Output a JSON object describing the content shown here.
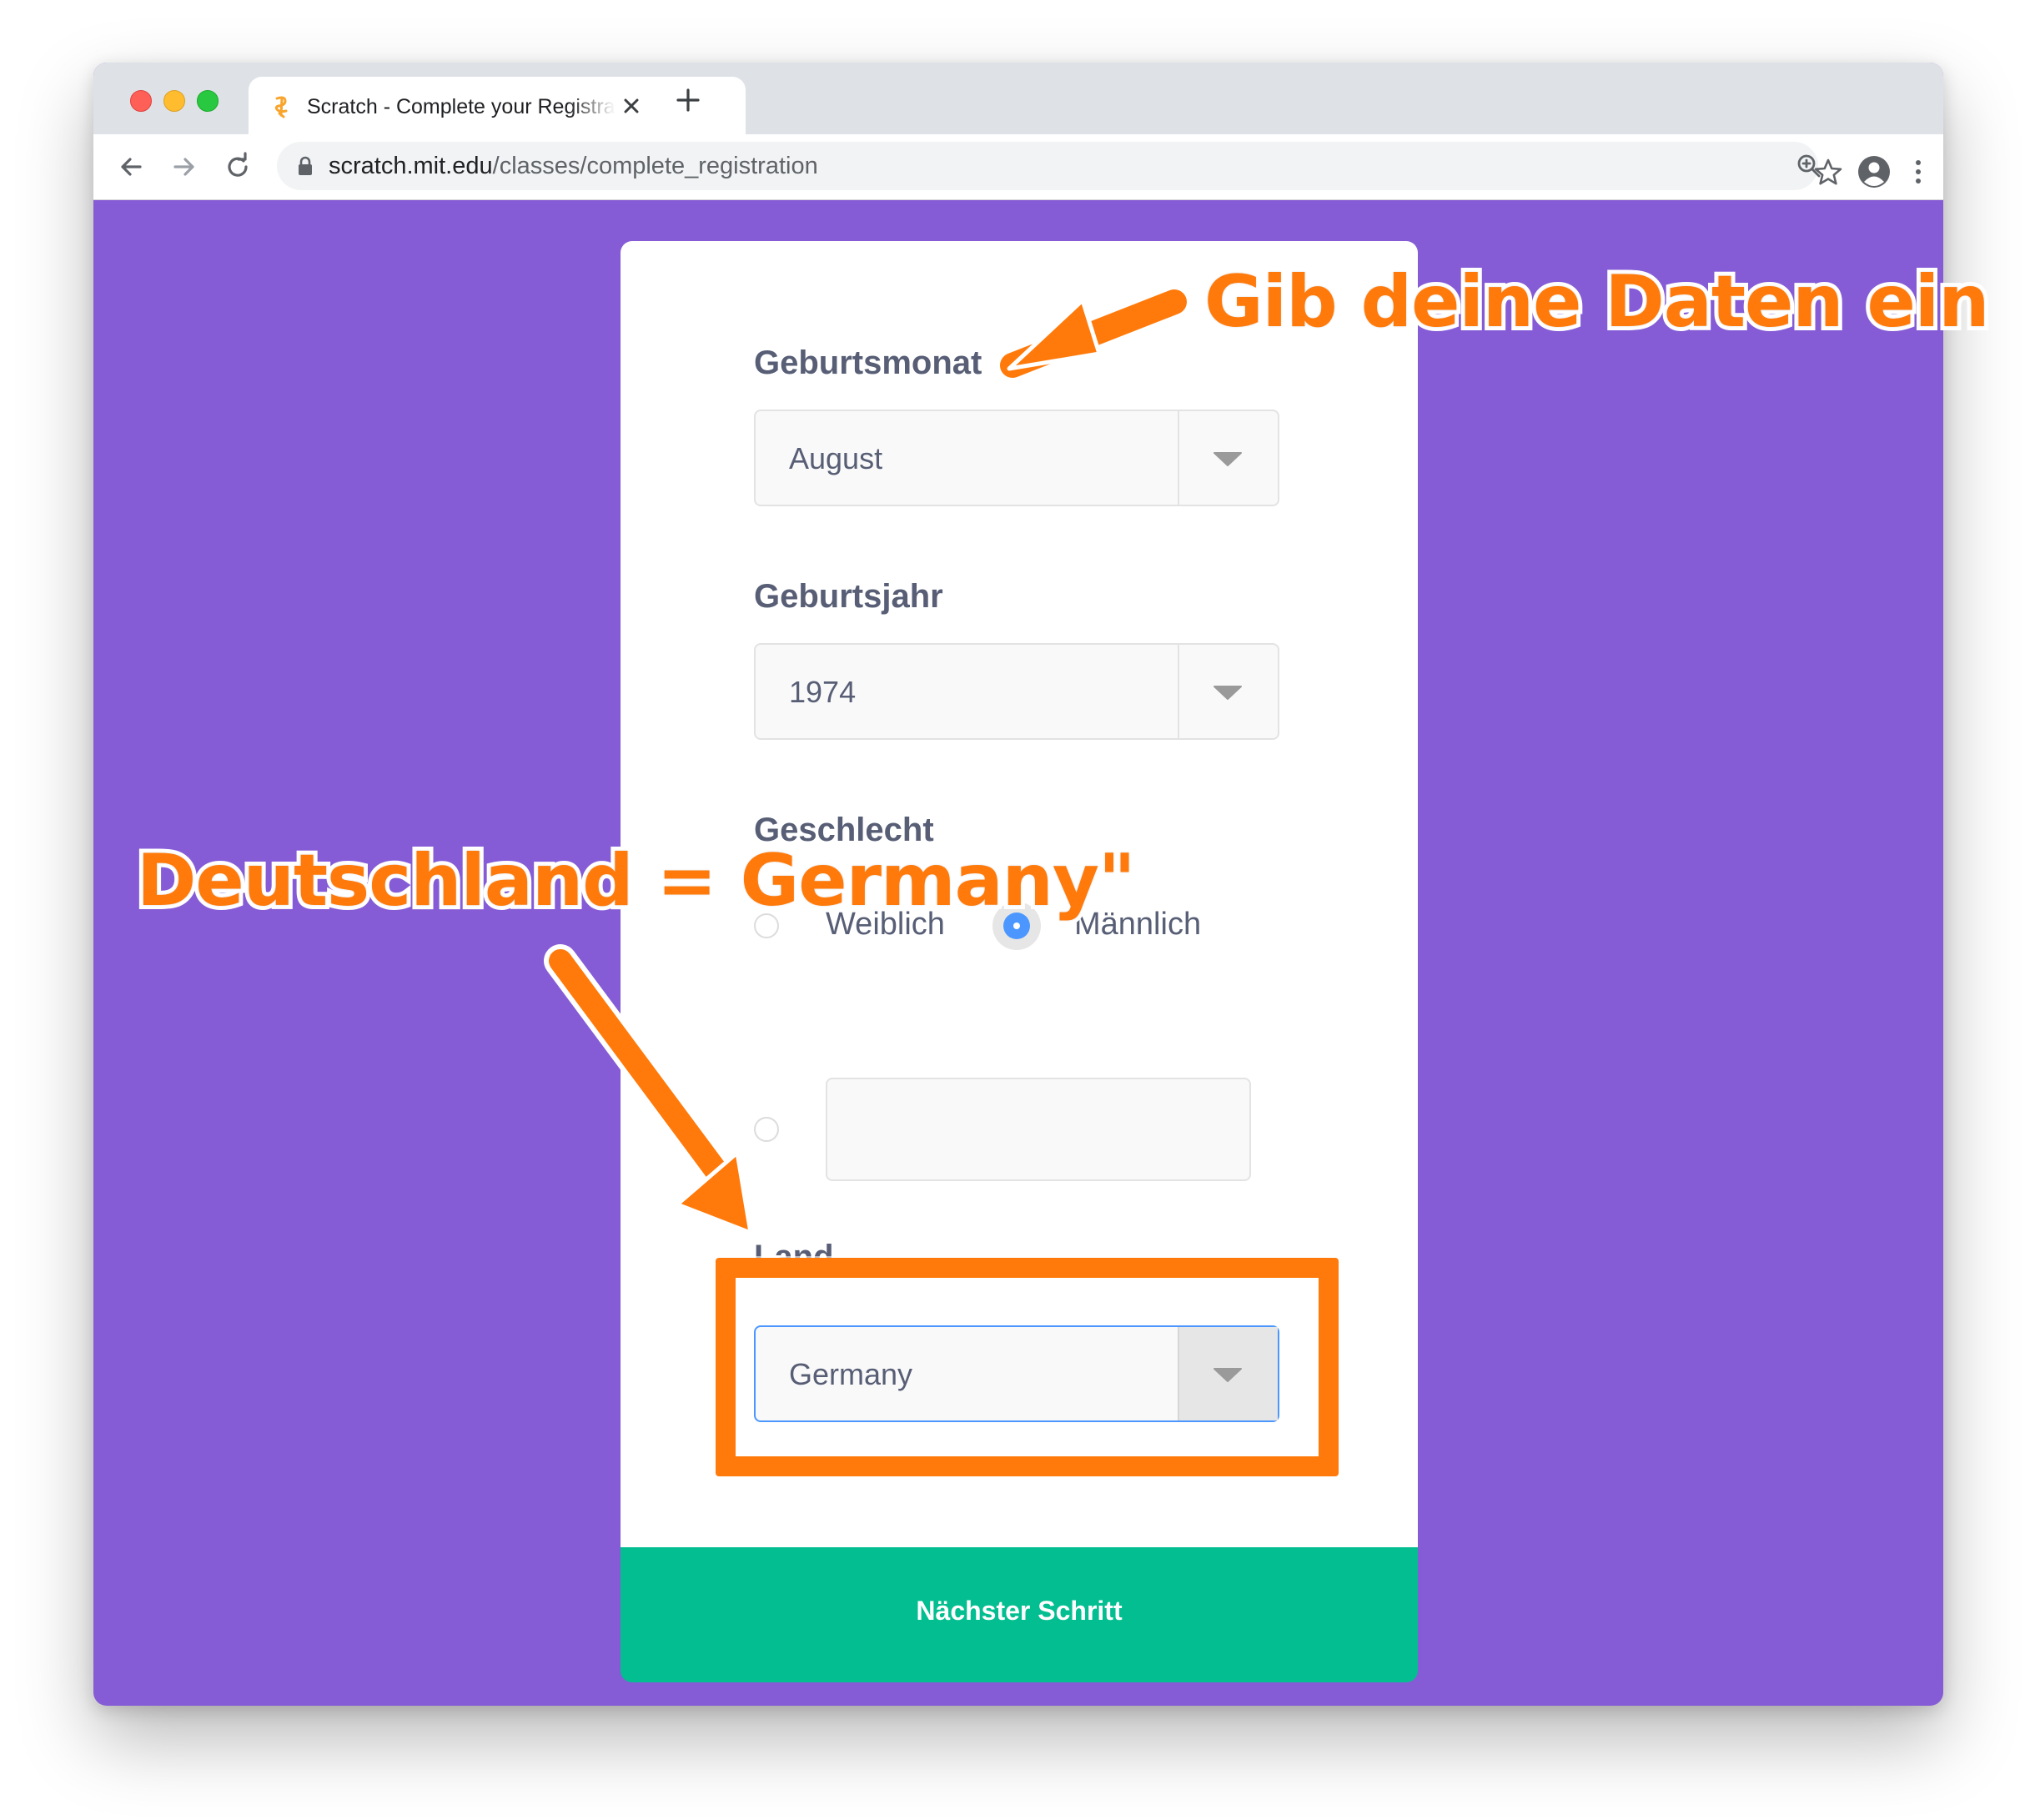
{
  "browser": {
    "tab_title": "Scratch - Complete your Registration",
    "url_domain": "scratch.mit.edu",
    "url_path": "/classes/complete_registration"
  },
  "form": {
    "birth_month_label": "Geburtsmonat",
    "birth_month_value": "August",
    "birth_year_label": "Geburtsjahr",
    "birth_year_value": "1974",
    "gender_label": "Geschlecht",
    "gender_option_female": "Weiblich",
    "gender_option_male": "Männlich",
    "gender_selected": "Männlich",
    "gender_other_value": "",
    "country_label": "Land",
    "country_value": "Germany",
    "submit_label": "Nächster Schritt"
  },
  "annotations": {
    "top_text": "Gib deine Daten ein",
    "left_text": "Deutschland = Germany\"",
    "accent_color": "#ff7a0a"
  },
  "colors": {
    "page_background": "#855cd6",
    "submit_button": "#03be90",
    "radio_selected": "#4c97ff"
  },
  "icons": [
    "back-arrow-icon",
    "forward-arrow-icon",
    "reload-icon",
    "lock-icon",
    "zoom-icon",
    "star-icon",
    "profile-icon",
    "kebab-menu-icon",
    "close-icon",
    "plus-icon",
    "caret-down-icon"
  ]
}
